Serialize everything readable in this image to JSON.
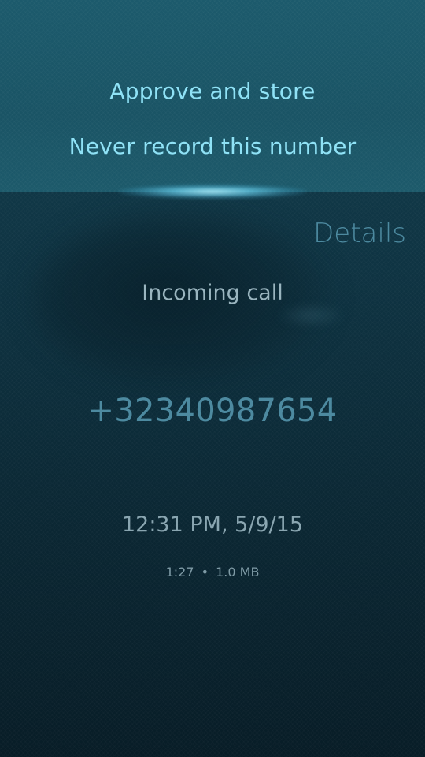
{
  "pulley_menu": {
    "items": [
      {
        "label": "Approve and store"
      },
      {
        "label": "Never record this number"
      }
    ]
  },
  "page": {
    "header": "Details"
  },
  "call": {
    "type": "Incoming call",
    "number": "+32340987654",
    "timestamp": "12:31 PM, 5/9/15",
    "duration": "1:27",
    "separator": "•",
    "size": "1.0 MB"
  },
  "colors": {
    "highlight": "#8fe2f6",
    "secondary_highlight": "#4d8aa0",
    "primary_text": "#9ab5bf"
  }
}
